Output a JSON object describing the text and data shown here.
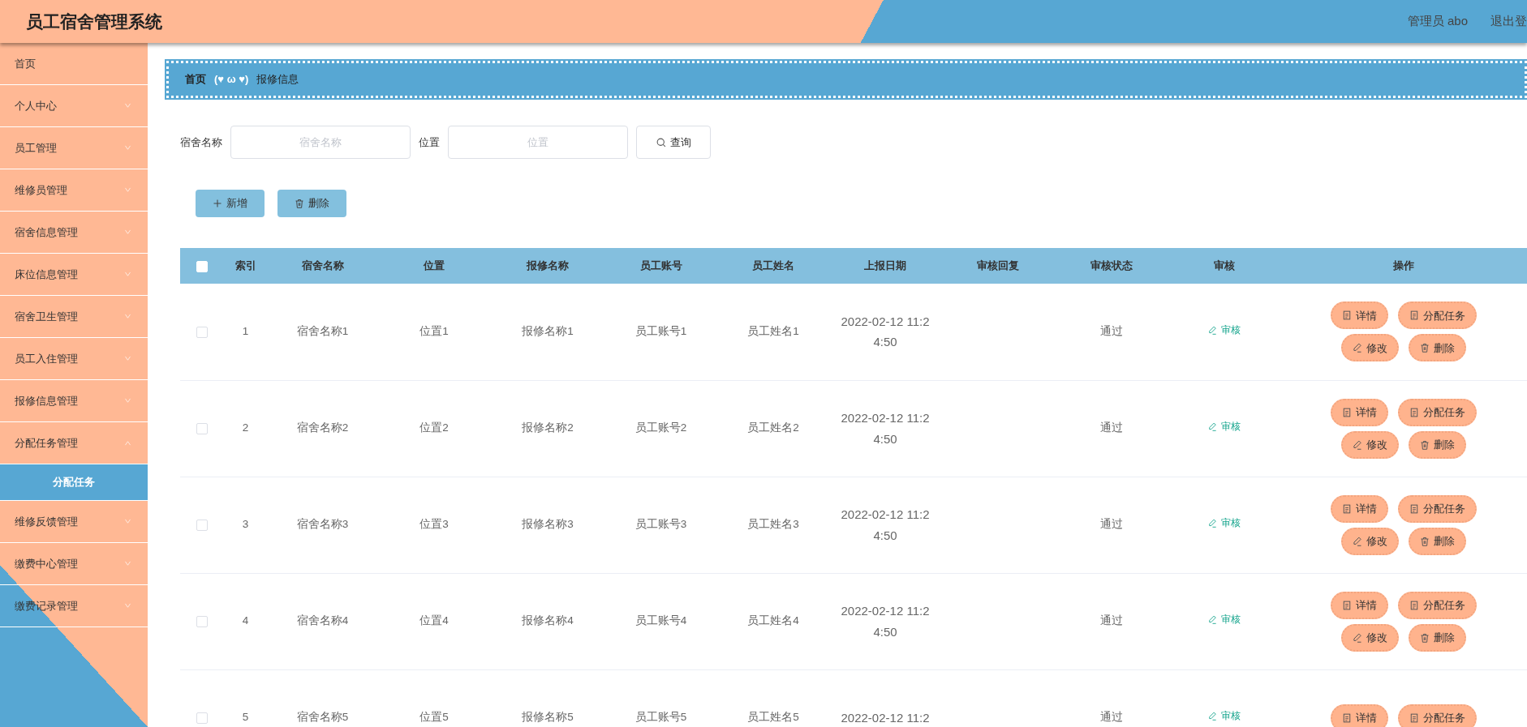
{
  "header": {
    "title": "员工宿舍管理系统",
    "user": "管理员 abo",
    "logout": "退出登"
  },
  "sidebar": {
    "items": [
      {
        "label": "首页",
        "kind": "link"
      },
      {
        "label": "个人中心",
        "kind": "menu",
        "expanded": false
      },
      {
        "label": "员工管理",
        "kind": "menu",
        "expanded": false
      },
      {
        "label": "维修员管理",
        "kind": "menu",
        "expanded": false
      },
      {
        "label": "宿舍信息管理",
        "kind": "menu",
        "expanded": false
      },
      {
        "label": "床位信息管理",
        "kind": "menu",
        "expanded": false
      },
      {
        "label": "宿舍卫生管理",
        "kind": "menu",
        "expanded": false
      },
      {
        "label": "员工入住管理",
        "kind": "menu",
        "expanded": false
      },
      {
        "label": "报修信息管理",
        "kind": "menu",
        "expanded": false
      },
      {
        "label": "分配任务管理",
        "kind": "menu",
        "expanded": true,
        "children": [
          {
            "label": "分配任务",
            "selected": true
          }
        ]
      },
      {
        "label": "维修反馈管理",
        "kind": "menu",
        "expanded": false
      },
      {
        "label": "缴费中心管理",
        "kind": "menu",
        "expanded": false
      },
      {
        "label": "缴费记录管理",
        "kind": "menu",
        "expanded": false
      }
    ]
  },
  "breadcrumb": {
    "home": "首页",
    "separator": "(♥ ω ♥)",
    "current": "报修信息"
  },
  "search": {
    "fields": [
      {
        "label": "宿舍名称",
        "placeholder": "宿舍名称"
      },
      {
        "label": "位置",
        "placeholder": "位置"
      }
    ],
    "button": "查询"
  },
  "toolbar": [
    {
      "label": "新增",
      "kind": "add"
    },
    {
      "label": "删除",
      "kind": "delete"
    }
  ],
  "table": {
    "select_all": {
      "checked": false
    },
    "columns": [
      "索引",
      "宿舍名称",
      "位置",
      "报修名称",
      "员工账号",
      "员工姓名",
      "上报日期",
      "审核回复",
      "审核状态",
      "审核",
      "操作"
    ],
    "rows": [
      {
        "checked": false,
        "cells": [
          "1",
          "宿舍名称1",
          "位置1",
          "报修名称1",
          "员工账号1",
          "员工姓名1",
          "2022-02-12 11:24:50",
          "",
          "通过"
        ],
        "audit": "审核",
        "actions": [
          {
            "label": "详情",
            "kind": "doc"
          },
          {
            "label": "分配任务",
            "kind": "doc"
          },
          {
            "label": "修改",
            "kind": "edit"
          },
          {
            "label": "删除",
            "kind": "trash"
          }
        ]
      },
      {
        "checked": false,
        "cells": [
          "2",
          "宿舍名称2",
          "位置2",
          "报修名称2",
          "员工账号2",
          "员工姓名2",
          "2022-02-12 11:24:50",
          "",
          "通过"
        ],
        "audit": "审核",
        "actions": [
          {
            "label": "详情",
            "kind": "doc"
          },
          {
            "label": "分配任务",
            "kind": "doc"
          },
          {
            "label": "修改",
            "kind": "edit"
          },
          {
            "label": "删除",
            "kind": "trash"
          }
        ]
      },
      {
        "checked": false,
        "cells": [
          "3",
          "宿舍名称3",
          "位置3",
          "报修名称3",
          "员工账号3",
          "员工姓名3",
          "2022-02-12 11:24:50",
          "",
          "通过"
        ],
        "audit": "审核",
        "actions": [
          {
            "label": "详情",
            "kind": "doc"
          },
          {
            "label": "分配任务",
            "kind": "doc"
          },
          {
            "label": "修改",
            "kind": "edit"
          },
          {
            "label": "删除",
            "kind": "trash"
          }
        ]
      },
      {
        "checked": false,
        "cells": [
          "4",
          "宿舍名称4",
          "位置4",
          "报修名称4",
          "员工账号4",
          "员工姓名4",
          "2022-02-12 11:24:50",
          "",
          "通过"
        ],
        "audit": "审核",
        "actions": [
          {
            "label": "详情",
            "kind": "doc"
          },
          {
            "label": "分配任务",
            "kind": "doc"
          },
          {
            "label": "修改",
            "kind": "edit"
          },
          {
            "label": "删除",
            "kind": "trash"
          }
        ]
      },
      {
        "checked": false,
        "cells": [
          "5",
          "宿舍名称5",
          "位置5",
          "报修名称5",
          "员工账号5",
          "员工姓名5",
          "2022-02-12 11:2",
          "",
          "通过"
        ],
        "audit": "审核",
        "actions": [
          {
            "label": "详情",
            "kind": "doc"
          },
          {
            "label": "分配任务",
            "kind": "doc"
          }
        ]
      }
    ]
  }
}
